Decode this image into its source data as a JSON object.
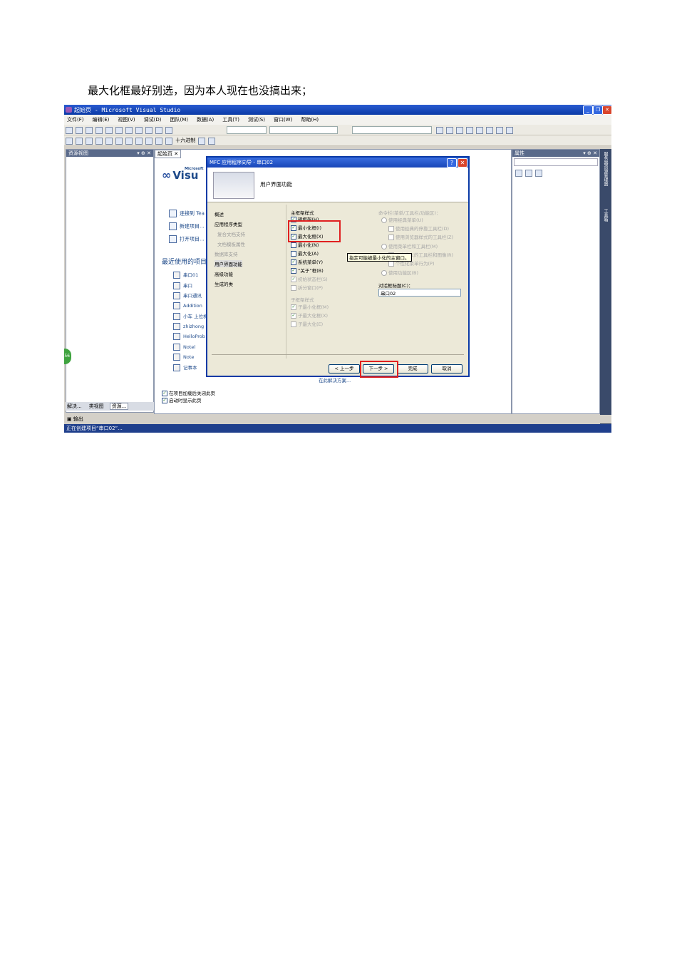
{
  "caption": "最大化框最好别选，因为本人现在也没搞出来；",
  "window": {
    "title": "起始页 - Microsoft Visual Studio",
    "controls": {
      "minimize": "_",
      "restore": "❐",
      "close": "✕"
    }
  },
  "menu": [
    "文件(F)",
    "编辑(E)",
    "视图(V)",
    "调试(D)",
    "团队(M)",
    "数据(A)",
    "工具(T)",
    "测试(S)",
    "窗口(W)",
    "帮助(H)"
  ],
  "toolbar2_label": "十六进制",
  "solution_panel": {
    "title": "资源视图",
    "pin": "▾ ⊕ ✕",
    "bottom_tabs": [
      "解决...",
      "类视图",
      "资源..."
    ]
  },
  "document": {
    "tab": "起始页",
    "logo_small": "Microsoft",
    "logo": "Visu",
    "links": [
      "连接到 Tea",
      "新建项目...",
      "打开项目..."
    ],
    "recent_title": "最近使用的项目",
    "recent_items": [
      "串口01",
      "串口",
      "串口通讯",
      "Addition",
      "小车 上位机",
      "zhizhong",
      "HelloProb",
      "Notel",
      "Note",
      "记事本"
    ],
    "options": [
      "在项目加载后关闭此页",
      "启动时显示此页"
    ],
    "bottom_link": "在此解决方案..."
  },
  "props_panel": {
    "title": "属性",
    "pin": "▾ ⊕ ✕"
  },
  "right_strip": [
    "服务器资源管理器",
    "工具箱"
  ],
  "output_label": "输出",
  "status": "正在创建项目“串口02”...",
  "badge": "56",
  "dialog": {
    "title": "MFC 应用程序向导 - 串口02",
    "help": "?",
    "close": "✕",
    "header": "用户界面功能",
    "nav": [
      {
        "label": "概述",
        "state": "normal"
      },
      {
        "label": "应用程序类型",
        "state": "normal"
      },
      {
        "label": "复合文档支持",
        "state": "dim"
      },
      {
        "label": "文档模板属性",
        "state": "dim"
      },
      {
        "label": "数据库支持",
        "state": "dim"
      },
      {
        "label": "用户界面功能",
        "state": "selected"
      },
      {
        "label": "高级功能",
        "state": "normal"
      },
      {
        "label": "生成的类",
        "state": "normal"
      }
    ],
    "main_frame_styles_label": "主框架样式",
    "main_frame_styles": [
      {
        "label": "粗框架(H)",
        "checked": true
      },
      {
        "label": "最小化框(I)",
        "checked": true
      },
      {
        "label": "最大化框(X)",
        "checked": true
      },
      {
        "label": "最小化(N)",
        "checked": false
      },
      {
        "label": "最大化(A)",
        "checked": false
      },
      {
        "label": "系统菜单(Y)",
        "checked": true
      },
      {
        "label": "“关于”框(B)",
        "checked": true
      },
      {
        "label": "初始状态栏(S)",
        "checked": true,
        "dim": true
      },
      {
        "label": "拆分窗口(P)",
        "checked": false,
        "dim": true
      }
    ],
    "child_frame_styles_label": "子框架样式",
    "child_frame_styles": [
      {
        "label": "子最小化框(M)",
        "checked": true
      },
      {
        "label": "子最大化框(X)",
        "checked": true
      },
      {
        "label": "子最大化(E)",
        "checked": false
      }
    ],
    "toolbar_label": "命令栏(菜单/工具栏/功能区)：",
    "toolbar_options": [
      "使用经典菜单(U)",
      "使用经典的停靠工具栏(D)",
      "使用浏览器样式的工具栏(Z)",
      "使用菜单栏和工具栏(M)",
      "用户定义的工具栏和图像(R)",
      "个性化菜单行为(P)",
      "使用功能区(B)"
    ],
    "dialog_title_label": "对话框标题(C)：",
    "dialog_title_value": "串口02",
    "tooltip": "指定可能被最小化的主窗口。",
    "buttons": {
      "prev": "< 上一步",
      "next": "下一步 >",
      "finish": "完成",
      "cancel": "取消"
    }
  }
}
